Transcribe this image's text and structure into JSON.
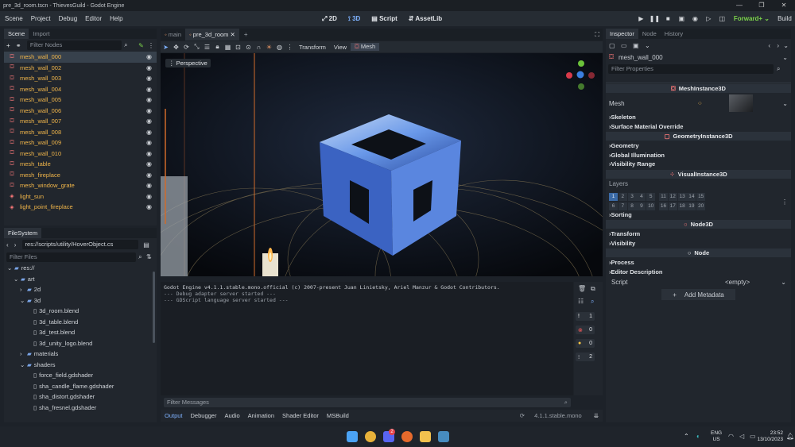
{
  "title": "pre_3d_room.tscn - ThievesGuild - Godot Engine",
  "window_controls": [
    "—",
    "❐",
    "✕"
  ],
  "menus": [
    "Scene",
    "Project",
    "Debug",
    "Editor",
    "Help"
  ],
  "workspaces": [
    {
      "label": "2D",
      "icon": "2d-icon"
    },
    {
      "label": "3D",
      "icon": "3d-icon"
    },
    {
      "label": "Script",
      "icon": "script-icon"
    },
    {
      "label": "AssetLib",
      "icon": "assetlib-icon"
    }
  ],
  "renderer": "Forward+",
  "build_label": "Build",
  "scene_dock": {
    "tabs": [
      "Scene",
      "Import"
    ],
    "filter_placeholder": "Filter Nodes",
    "nodes": [
      {
        "label": "mesh_wall_000",
        "type": "mesh"
      },
      {
        "label": "mesh_wall_002",
        "type": "mesh"
      },
      {
        "label": "mesh_wall_003",
        "type": "mesh"
      },
      {
        "label": "mesh_wall_004",
        "type": "mesh"
      },
      {
        "label": "mesh_wall_005",
        "type": "mesh"
      },
      {
        "label": "mesh_wall_006",
        "type": "mesh"
      },
      {
        "label": "mesh_wall_007",
        "type": "mesh"
      },
      {
        "label": "mesh_wall_008",
        "type": "mesh"
      },
      {
        "label": "mesh_wall_009",
        "type": "mesh"
      },
      {
        "label": "mesh_wall_010",
        "type": "mesh"
      },
      {
        "label": "mesh_table",
        "type": "mesh"
      },
      {
        "label": "mesh_fireplace",
        "type": "mesh"
      },
      {
        "label": "mesh_window_grate",
        "type": "mesh"
      },
      {
        "label": "light_sun",
        "type": "light"
      },
      {
        "label": "light_point_fireplace",
        "type": "light"
      }
    ]
  },
  "filesystem": {
    "tab": "FileSystem",
    "path": "res://scripts/utility/HoverObject.cs",
    "filter_placeholder": "Filter Files",
    "items": [
      {
        "label": "res://",
        "indent": 0,
        "kind": "folder",
        "arrow": "⌄"
      },
      {
        "label": "art",
        "indent": 1,
        "kind": "folder",
        "arrow": "⌄"
      },
      {
        "label": "2d",
        "indent": 2,
        "kind": "folder",
        "arrow": "›"
      },
      {
        "label": "3d",
        "indent": 2,
        "kind": "folder",
        "arrow": "⌄"
      },
      {
        "label": "3d_room.blend",
        "indent": 3,
        "kind": "file",
        "arrow": ""
      },
      {
        "label": "3d_table.blend",
        "indent": 3,
        "kind": "file",
        "arrow": ""
      },
      {
        "label": "3d_test.blend",
        "indent": 3,
        "kind": "file",
        "arrow": ""
      },
      {
        "label": "3d_unity_logo.blend",
        "indent": 3,
        "kind": "file",
        "arrow": ""
      },
      {
        "label": "materials",
        "indent": 2,
        "kind": "folder",
        "arrow": "›"
      },
      {
        "label": "shaders",
        "indent": 2,
        "kind": "folder",
        "arrow": "⌄"
      },
      {
        "label": "force_field.gdshader",
        "indent": 3,
        "kind": "file",
        "arrow": ""
      },
      {
        "label": "sha_candle_flame.gdshader",
        "indent": 3,
        "kind": "file",
        "arrow": ""
      },
      {
        "label": "sha_distort.gdshader",
        "indent": 3,
        "kind": "file",
        "arrow": ""
      },
      {
        "label": "sha_fresnel.gdshader",
        "indent": 3,
        "kind": "file",
        "arrow": ""
      }
    ]
  },
  "editor_tabs": [
    "main",
    "pre_3d_room"
  ],
  "viewport": {
    "toolbar_labels": [
      "Transform",
      "View",
      "Mesh"
    ],
    "perspective_label": "Perspective",
    "gizmo_axes": [
      "Y",
      "X",
      "Z"
    ]
  },
  "console": {
    "lines": [
      "Godot Engine v4.1.1.stable.mono.official (c) 2007-present Juan Linietsky, Ariel Manzur & Godot Contributors.",
      "--- Debug adapter server started ---",
      "--- GDScript language server started ---"
    ],
    "filter_placeholder": "Filter Messages",
    "counters": [
      "1",
      "0",
      "0",
      "2"
    ],
    "bottom_tabs": [
      "Output",
      "Debugger",
      "Audio",
      "Animation",
      "Shader Editor",
      "MSBuild"
    ],
    "version": "4.1.1.stable.mono"
  },
  "inspector": {
    "tabs": [
      "Inspector",
      "Node",
      "History"
    ],
    "node_name": "mesh_wall_000",
    "filter_placeholder": "Filter Properties",
    "class_header": "MeshInstance3D",
    "mesh_label": "Mesh",
    "sections_a": [
      "Skeleton",
      "Surface Material Override"
    ],
    "geometry_header": "GeometryInstance3D",
    "sections_b": [
      "Geometry",
      "Global Illumination",
      "Visibility Range"
    ],
    "visual_header": "VisualInstance3D",
    "layers_label": "Layers",
    "layers": [
      "1",
      "2",
      "3",
      "4",
      "5",
      "11",
      "12",
      "13",
      "14",
      "15",
      "6",
      "7",
      "8",
      "9",
      "10",
      "16",
      "17",
      "18",
      "19",
      "20"
    ],
    "sections_c": [
      "Sorting"
    ],
    "node3d_header": "Node3D",
    "sections_d": [
      "Transform",
      "Visibility"
    ],
    "node_header": "Node",
    "sections_e": [
      "Process",
      "Editor Description"
    ],
    "script_label": "Script",
    "script_value": "<empty>",
    "add_metadata": "Add Metadata"
  },
  "taskbar": {
    "lang": "ENG",
    "region": "US",
    "time": "23:52",
    "date": "13/10/2023",
    "badge": "2"
  },
  "colors": {
    "accent": "#7fb2ff",
    "node_text": "#f0b54a",
    "renderer": "#7bd34a"
  }
}
